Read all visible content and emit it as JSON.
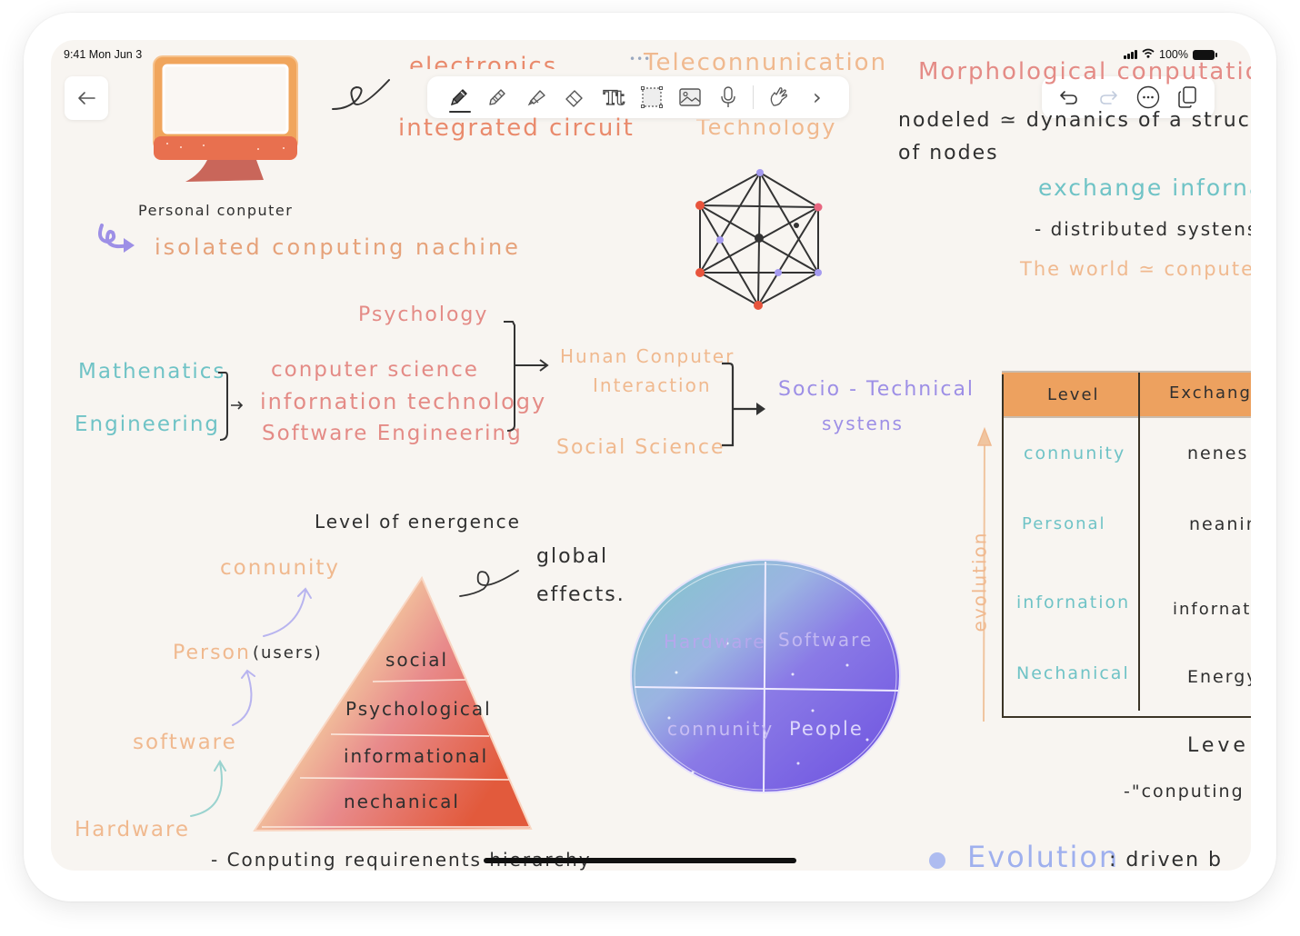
{
  "status_bar": {
    "time": "9:41  Mon Jun 3",
    "battery": "100%"
  },
  "toolbar": {
    "tools": [
      {
        "name": "pen",
        "active": true
      },
      {
        "name": "pencil",
        "active": false
      },
      {
        "name": "highlighter",
        "active": false
      },
      {
        "name": "eraser",
        "active": false
      },
      {
        "name": "text",
        "label": "Tt",
        "active": false
      },
      {
        "name": "lasso-select",
        "active": false
      },
      {
        "name": "image",
        "active": false
      },
      {
        "name": "microphone",
        "active": false
      },
      {
        "name": "hand-pointer",
        "active": false
      },
      {
        "name": "more-tools",
        "label": "›",
        "active": false
      }
    ],
    "grabber": "•••"
  },
  "right_tools": [
    "undo",
    "redo",
    "more",
    "pages"
  ],
  "notes": {
    "personal_computer": "Personal  conputer",
    "isolated": "isolated  conputing  nachine",
    "electronics": "electronics",
    "integrated_circuit": "integrated  circuit",
    "telecommunication": "Teleconnunication",
    "technology": "Technology",
    "morphological": "Morphological  conputation",
    "modeled": "nodeled ≃  dynanics  of  a  structu",
    "of_nodes": "of  nodes",
    "exchange": "exchange  inforna",
    "distributed": "-  distributed  systens",
    "world_computer": "The  world  ≃  conputer",
    "psychology": "Psychology",
    "mathematics": "Mathenatics",
    "engineering": "Engineering",
    "computer_science": "conputer  science",
    "information_technology": "infornation  technology",
    "software_engineering": "Software  Engineering",
    "hci_line1": "Hunan  Conputer",
    "hci_line2": "Interaction",
    "social_science": "Social  Science",
    "socio_line1": "Socio - Technical",
    "socio_line2": "systens",
    "level_of_emergence": "Level  of  energence",
    "global": "global",
    "effects": "effects.",
    "community": "connunity",
    "person": "Person",
    "users": "(users)",
    "software": "software",
    "hardware": "Hardware",
    "bottom_line": "-  Conputing  requirenents  hierarchy  -",
    "level_label": "Level",
    "computing_quote": "-\"conputing  i",
    "evolution_bullet": "Evolution",
    "driven_by": ":  driven  b",
    "evolution_axis": "evolution"
  },
  "pyramid": {
    "layers": [
      "social",
      "Psychological",
      "informational",
      "nechanical"
    ]
  },
  "circle": {
    "quadrants": [
      "Hardware",
      "Software",
      "connunity",
      "People"
    ]
  },
  "table": {
    "headers": [
      "Level",
      "Exchang"
    ],
    "rows": [
      [
        "connunity",
        "nenes"
      ],
      [
        "Personal",
        "neanin"
      ],
      [
        "infornation",
        "infornati"
      ],
      [
        "Nechanical",
        "Energy"
      ]
    ]
  },
  "colors": {
    "canvas": "#f8f5f1",
    "orange": "#e6a27a",
    "pink": "#e48b86",
    "teal": "#6fc3c6",
    "purple": "#9d8fe6",
    "table_header": "#eda15f"
  }
}
